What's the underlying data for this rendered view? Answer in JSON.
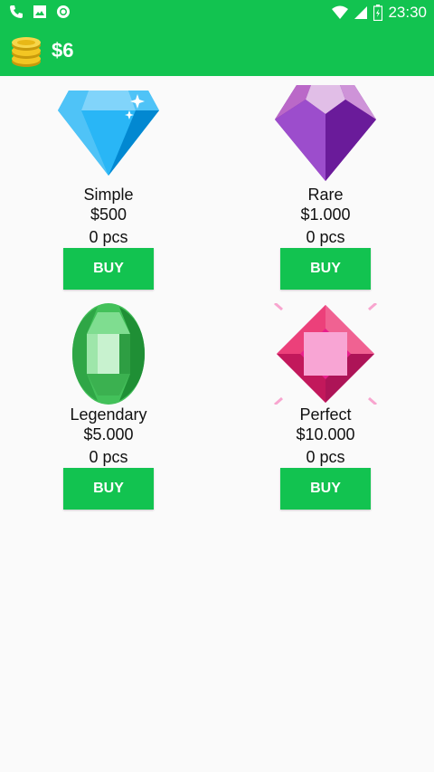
{
  "status_bar": {
    "time": "23:30",
    "left_icons": [
      "phone-icon",
      "image-icon",
      "circle-app-icon"
    ],
    "right_icons": [
      "wifi-icon",
      "signal-icon",
      "battery-icon"
    ]
  },
  "header": {
    "balance": "$6",
    "icon": "coins-icon",
    "color": "#12c350"
  },
  "shop": {
    "items": [
      {
        "name": "Simple",
        "price": "$500",
        "count": "0 pcs",
        "buy_label": "BUY",
        "icon": "blue-diamond-icon"
      },
      {
        "name": "Rare",
        "price": "$1.000",
        "count": "0 pcs",
        "buy_label": "BUY",
        "icon": "purple-gem-icon"
      },
      {
        "name": "Legendary",
        "price": "$5.000",
        "count": "0 pcs",
        "buy_label": "BUY",
        "icon": "green-emerald-icon"
      },
      {
        "name": "Perfect",
        "price": "$10.000",
        "count": "0 pcs",
        "buy_label": "BUY",
        "icon": "pink-gem-icon"
      }
    ]
  }
}
